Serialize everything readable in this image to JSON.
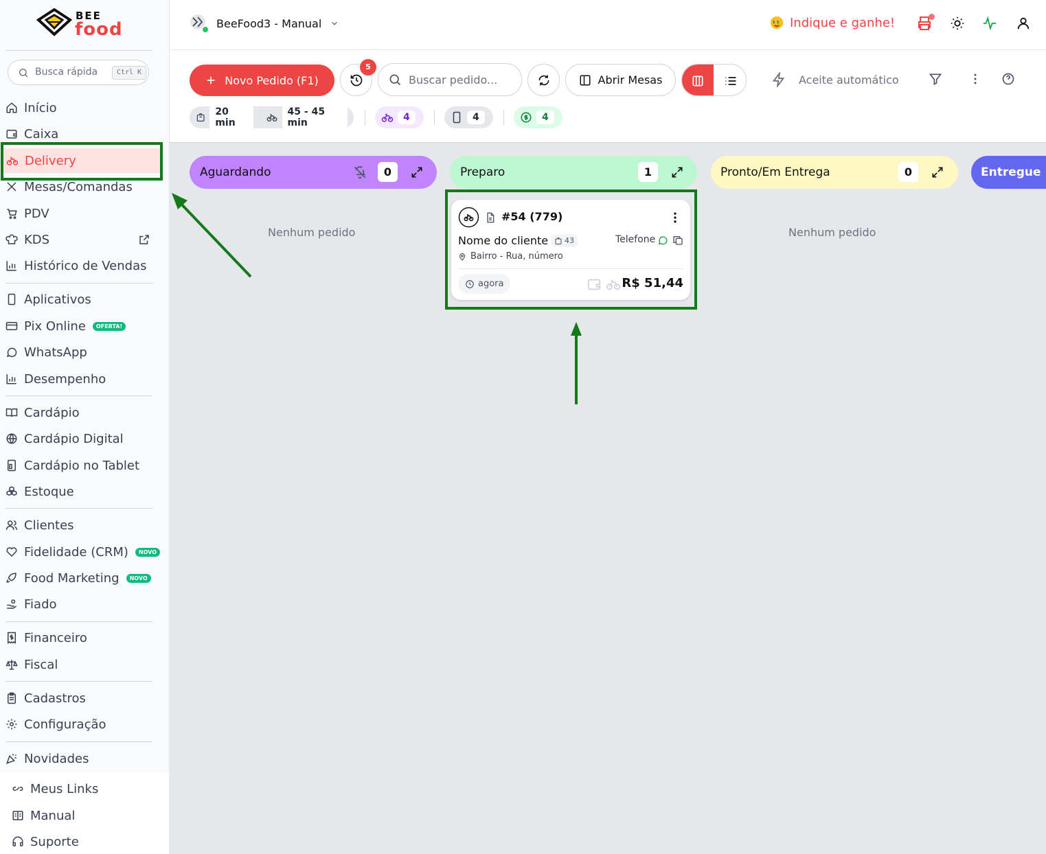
{
  "brand": {
    "line1": "BEE",
    "line2": "food"
  },
  "search": {
    "placeholder": "Busca rápida",
    "shortcut": "Ctrl K"
  },
  "sidebar": {
    "items": [
      {
        "label": "Início",
        "icon": "home-icon"
      },
      {
        "label": "Caixa",
        "icon": "wallet-icon"
      },
      {
        "label": "Delivery",
        "icon": "bike-icon"
      },
      {
        "label": "Mesas/Comandas",
        "icon": "utensils-icon"
      },
      {
        "label": "PDV",
        "icon": "cart-icon"
      },
      {
        "label": "KDS",
        "icon": "chef-hat-icon"
      },
      {
        "label": "Histórico de Vendas",
        "icon": "bar-chart-icon"
      },
      {
        "label": "Aplicativos",
        "icon": "smartphone-icon"
      },
      {
        "label": "Pix Online",
        "icon": "card-icon",
        "badge": "OFERTA!"
      },
      {
        "label": "WhatsApp",
        "icon": "message-circle-icon"
      },
      {
        "label": "Desempenho",
        "icon": "bar-chart-icon"
      },
      {
        "label": "Cardápio",
        "icon": "book-icon"
      },
      {
        "label": "Cardápio Digital",
        "icon": "globe-icon"
      },
      {
        "label": "Cardápio no Tablet",
        "icon": "tablet-icon"
      },
      {
        "label": "Estoque",
        "icon": "boxes-icon"
      },
      {
        "label": "Clientes",
        "icon": "users-icon"
      },
      {
        "label": "Fidelidade (CRM)",
        "icon": "heart-icon",
        "badge": "NOVO"
      },
      {
        "label": "Food Marketing",
        "icon": "rocket-icon",
        "badge": "NOVO"
      },
      {
        "label": "Fiado",
        "icon": "hand-coins-icon"
      },
      {
        "label": "Financeiro",
        "icon": "receipt-icon"
      },
      {
        "label": "Fiscal",
        "icon": "scale-icon"
      },
      {
        "label": "Cadastros",
        "icon": "clipboard-icon"
      },
      {
        "label": "Configuração",
        "icon": "gear-icon"
      },
      {
        "label": "Novidades",
        "icon": "party-icon"
      }
    ],
    "bottom": [
      {
        "label": "Meus Links",
        "icon": "link-icon"
      },
      {
        "label": "Manual",
        "icon": "book-open-icon"
      },
      {
        "label": "Suporte",
        "icon": "headphones-icon"
      }
    ]
  },
  "topbar": {
    "store": "BeeFood3 - Manual",
    "referral": "Indique e ganhe!"
  },
  "toolbar": {
    "new_order": "Novo Pedido (F1)",
    "history_badge": "5",
    "search_placeholder": "Buscar pedido...",
    "open_tables": "Abrir Mesas",
    "auto_accept": "Aceite automático",
    "prep_time": "20 min",
    "delivery_time": "45 - 45 min",
    "delivery_count": "4",
    "app_count": "4",
    "money_count": "4"
  },
  "columns": [
    {
      "title": "Aguardando",
      "count": "0",
      "empty": "Nenhum pedido",
      "color": "#c084fc"
    },
    {
      "title": "Preparo",
      "count": "1",
      "color": "#bbf7d0"
    },
    {
      "title": "Pronto/Em Entrega",
      "count": "0",
      "empty": "Nenhum pedido",
      "color": "#fef9c3"
    },
    {
      "title": "Entregue",
      "color": "#6366f1"
    }
  ],
  "order": {
    "number": "#54 (779)",
    "customer": "Nome do cliente",
    "orders_count": "43",
    "phone_label": "Telefone",
    "address": "Bairro - Rua, número",
    "time": "agora",
    "total": "R$ 51,44"
  }
}
